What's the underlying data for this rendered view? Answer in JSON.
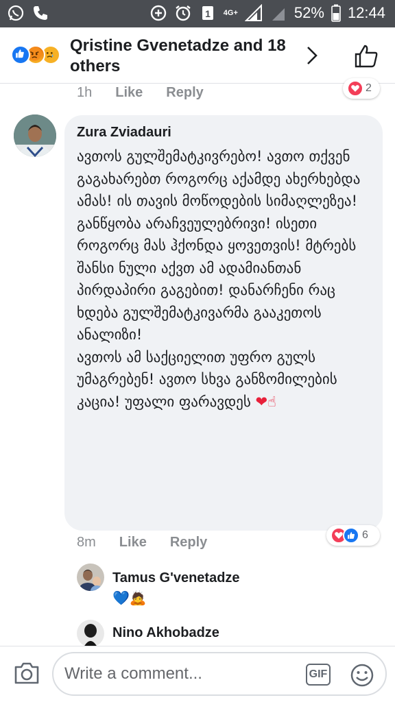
{
  "status_bar": {
    "network": "4G+",
    "battery": "52%",
    "time": "12:44",
    "icons": [
      "whatsapp-icon",
      "phone-icon",
      "data-saver-icon",
      "alarm-icon",
      "sim-icon",
      "signal-icon",
      "battery-icon"
    ]
  },
  "header": {
    "title": "Qristine Gvenetadze and 18 others",
    "reactions": [
      "like-reaction-icon",
      "angry-reaction-icon",
      "sad-reaction-icon"
    ]
  },
  "prev_comment": {
    "time": "1h",
    "like_label": "Like",
    "reply_label": "Reply",
    "reaction_count": "2"
  },
  "comment": {
    "author": "Zura Zviadauri",
    "text": "ავთოს გულშემატკივრებო! ავთო თქვენ გაგახარებთ როგორც აქამდე ახერხებდა ამას! ის თავის მოწოდების სიმაღლეზეა! განწყობა არაჩვეულებრივი! ისეთი როგორც მას ჰქონდა ყოვეთვის! მტრებს შანსი ნული აქვთ ამ ადამიანთან პირდაპირი გაგებით! დანარჩენი რაც ხდება გულშემატკივარმა გააკეთოს ანალიზი!\nავთოს ამ საქციელით უფრო გულს უმაგრებენ! ავთო სხვა განზომილების კაცია! უფალი ფარავდეს",
    "emoji": "❤☝",
    "time": "8m",
    "like_label": "Like",
    "reply_label": "Reply",
    "reaction_count": "6"
  },
  "replies": [
    {
      "author": "Tamus G'venetadze",
      "emojis": "💙🙇"
    },
    {
      "author": "Nino Akhobadze"
    }
  ],
  "composer": {
    "placeholder": "Write a comment...",
    "gif_label": "GIF"
  },
  "colors": {
    "accent": "#1877f2",
    "love": "#f33e58",
    "bubble": "#f0f2f5",
    "status_bar": "#4a4d52"
  }
}
